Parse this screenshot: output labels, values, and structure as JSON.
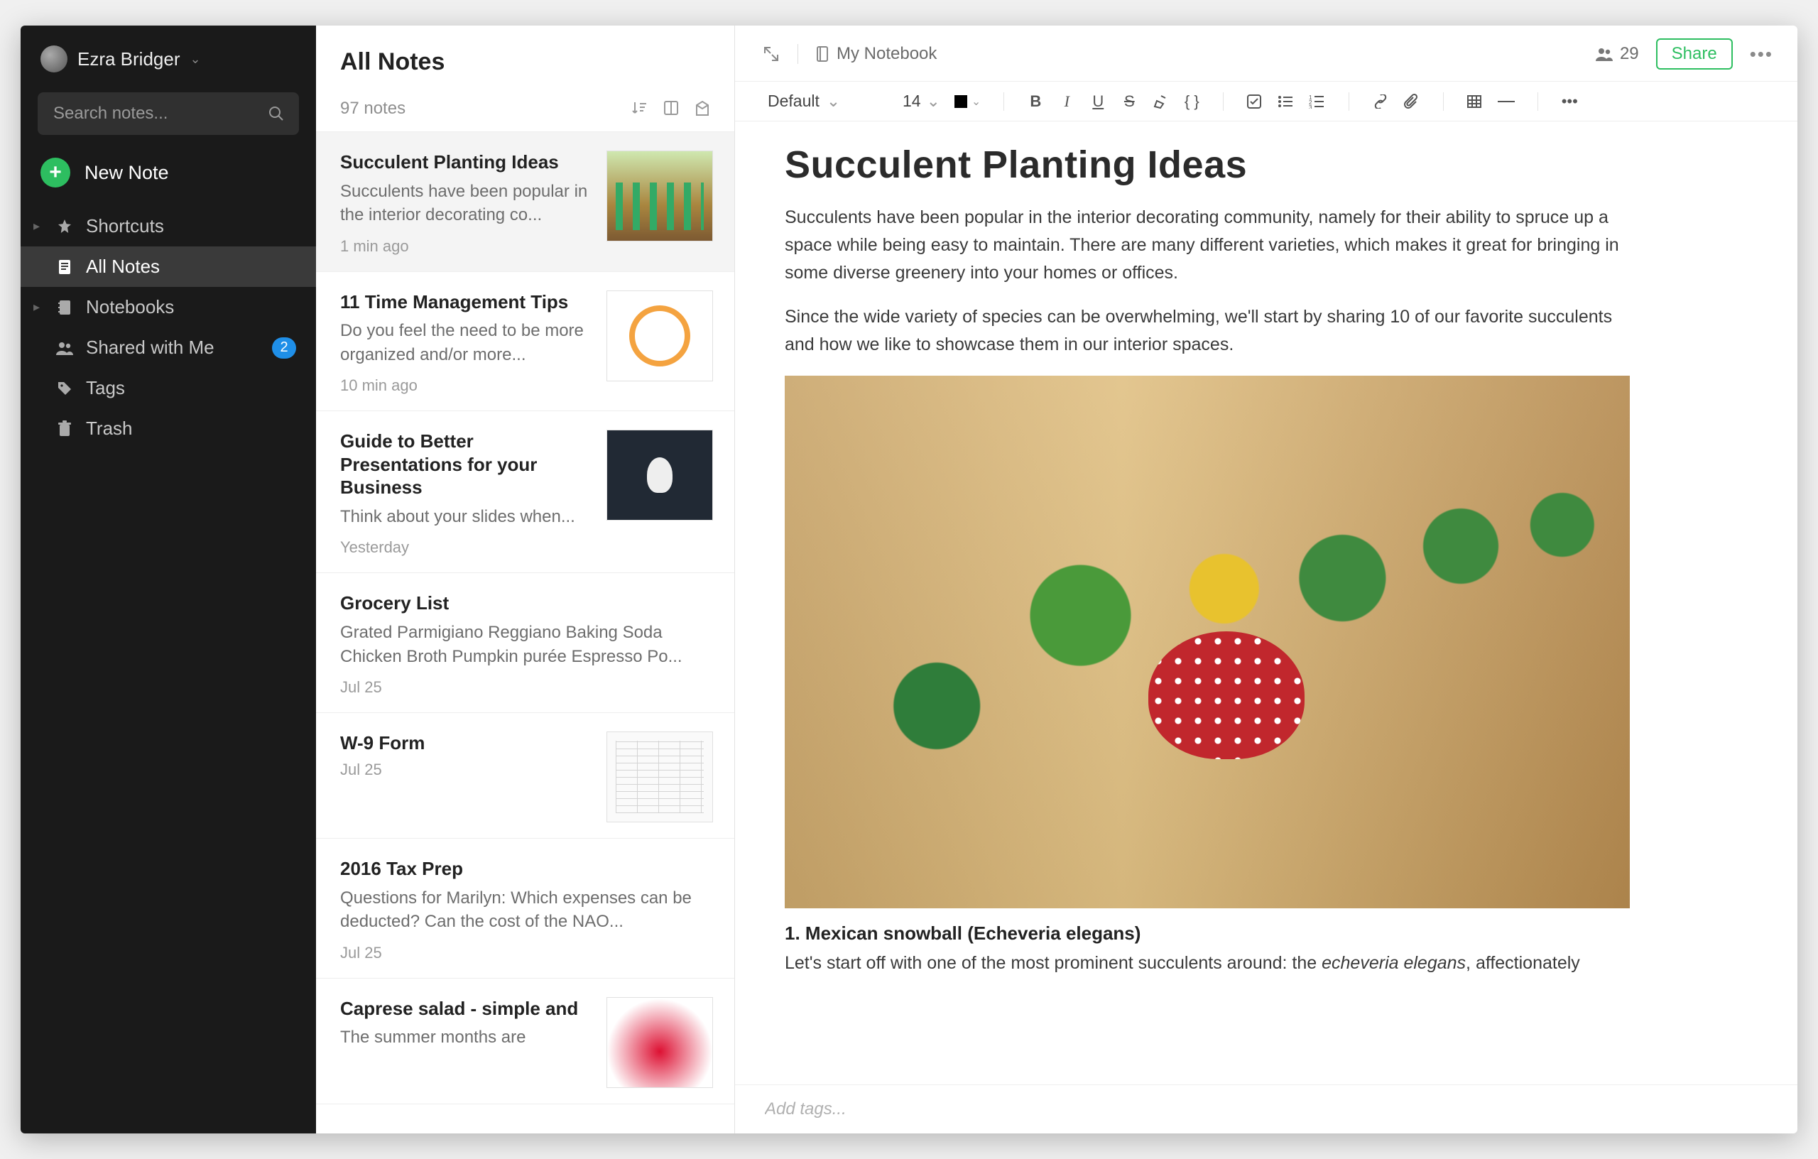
{
  "user": {
    "name": "Ezra Bridger"
  },
  "search": {
    "placeholder": "Search notes..."
  },
  "newNote": {
    "label": "New Note"
  },
  "nav": {
    "shortcuts": "Shortcuts",
    "allNotes": "All Notes",
    "notebooks": "Notebooks",
    "shared": "Shared with Me",
    "sharedBadge": "2",
    "tags": "Tags",
    "trash": "Trash"
  },
  "notelist": {
    "title": "All Notes",
    "count": "97 notes"
  },
  "notes": [
    {
      "title": "Succulent Planting Ideas",
      "snippet": "Succulents have been popular in the interior decorating co...",
      "time": "1 min ago",
      "thumb": "succulent"
    },
    {
      "title": "11 Time Management Tips",
      "snippet": "Do you feel the need to be more organized and/or more...",
      "time": "10 min ago",
      "thumb": "stopwatch"
    },
    {
      "title": "Guide to Better Presentations for your Business",
      "snippet": "Think about your slides when...",
      "time": "Yesterday",
      "thumb": "bulb"
    },
    {
      "title": "Grocery List",
      "snippet": "Grated Parmigiano Reggiano Baking Soda Chicken Broth Pumpkin purée Espresso Po...",
      "time": "Jul 25",
      "thumb": ""
    },
    {
      "title": "W-9 Form",
      "snippet": "",
      "time": "Jul 25",
      "thumb": "form"
    },
    {
      "title": "2016 Tax Prep",
      "snippet": "Questions for Marilyn: Which expenses can be deducted? Can the cost of the NAO...",
      "time": "Jul 25",
      "thumb": ""
    },
    {
      "title": "Caprese salad - simple and",
      "snippet": "The summer months are",
      "time": "",
      "thumb": "salad"
    }
  ],
  "editorHeader": {
    "notebook": "My Notebook",
    "shareCount": "29",
    "shareLabel": "Share"
  },
  "toolbar": {
    "font": "Default",
    "size": "14"
  },
  "doc": {
    "title": "Succulent Planting Ideas",
    "p1": "Succulents have been popular in the interior decorating community, namely for their ability to spruce up a space while being easy to maintain. There are many different varieties, which makes it great for bringing in some diverse greenery into your homes or offices.",
    "p2": "Since the wide variety of species can be overwhelming, we'll start by sharing 10 of our favorite succulents and how we like to showcase them in our interior spaces.",
    "h1": "1. Mexican snowball (Echeveria elegans)",
    "body1a": "Let's start off with one of the most prominent succulents around: the ",
    "body1em": "echeveria elegans",
    "body1b": ", affectionately"
  },
  "tags": {
    "placeholder": "Add tags..."
  }
}
